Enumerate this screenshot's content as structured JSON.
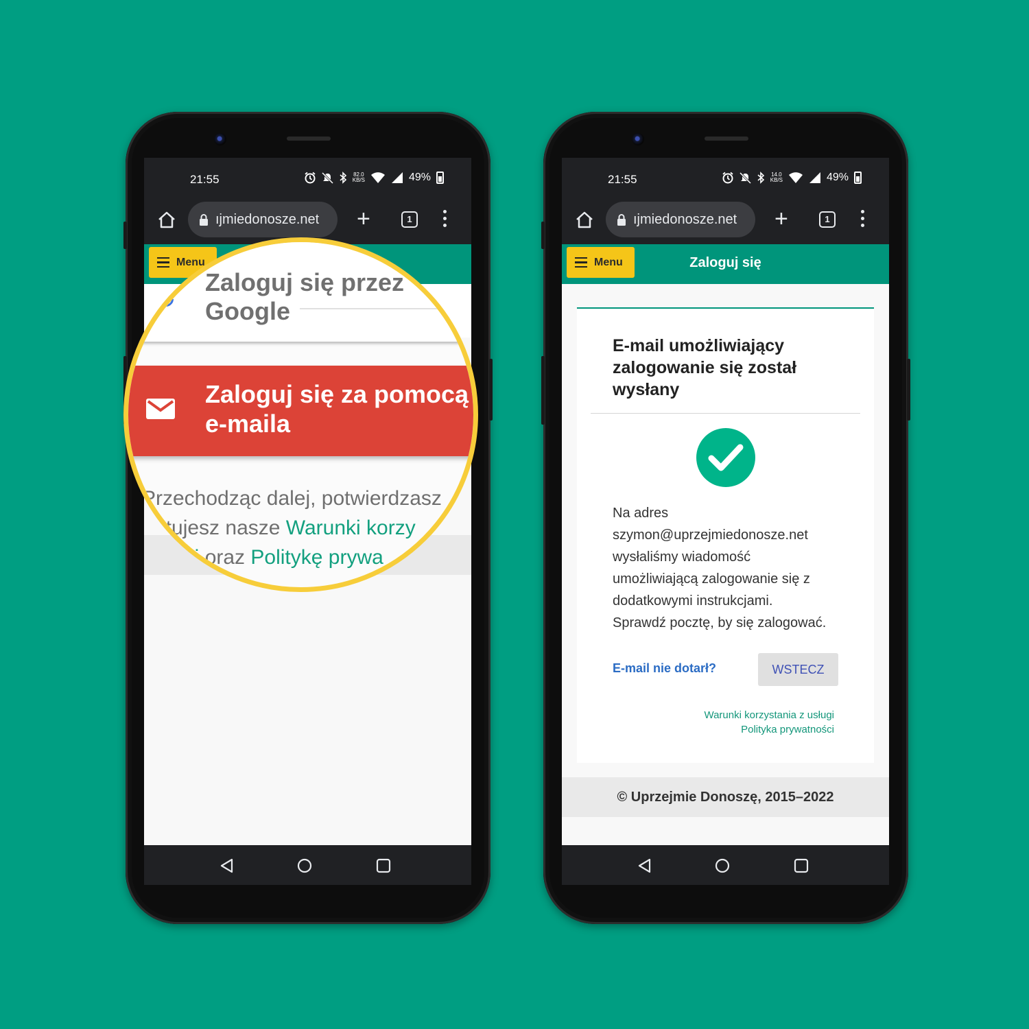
{
  "status": {
    "time": "21:55",
    "speed_left": [
      "82.0",
      "KB/S"
    ],
    "speed_right": [
      "14.0",
      "KB/S"
    ],
    "battery": "49%"
  },
  "browser": {
    "url": "ıjmiedonosze.net",
    "tab_count": "1"
  },
  "app": {
    "menu_label": "Menu",
    "login_title": "Zaloguj się"
  },
  "magnifier": {
    "google_line1": "Zaloguj się przez",
    "google_line2": "Google",
    "email_line1": "Zaloguj się za pomocą",
    "email_line2": "e-maila",
    "terms_line1": "Przechodząc dalej, potwierdzasz",
    "terms_line2_pre": "otujesz nasze ",
    "terms_line2_link": "Warunki korzy",
    "terms_line3_link1": "gi",
    "terms_line3_mid": " oraz ",
    "terms_line3_link2": "Politykę prywa",
    "year_fragment": "22"
  },
  "confirmation": {
    "heading": "E-mail umożliwiający zalogowanie się został wysłany",
    "message_lines": [
      "Na adres",
      "szymon@uprzejmiedonosze.net",
      "wysłaliśmy wiadomość",
      "umożliwiającą zalogowanie się z",
      "dodatkowymi instrukcjami.",
      "Sprawdź pocztę, by się zalogować."
    ],
    "email_missing": "E-mail nie dotarł?",
    "back_button": "WSTECZ",
    "terms_link": "Warunki korzystania z usługi",
    "privacy_link": "Polityka prywatności"
  },
  "footer": {
    "copyright": "© Uprzejmie Donoszę, 2015–2022"
  },
  "colors": {
    "background": "#009e82",
    "appbar": "#00957b",
    "menu_button": "#f5c518",
    "email_button": "#dc4337",
    "magnifier_ring": "#f7cd3a",
    "check": "#00b48a",
    "link": "#13967a"
  },
  "icons": [
    "home-icon",
    "lock-icon",
    "plus-icon",
    "tabs-icon",
    "kebab-icon",
    "menu-icon",
    "check-icon",
    "envelope-icon",
    "back-nav-icon",
    "home-nav-icon",
    "recents-nav-icon",
    "alarm-icon",
    "mute-icon",
    "bluetooth-icon",
    "wifi-icon",
    "signal-icon",
    "battery-icon"
  ]
}
